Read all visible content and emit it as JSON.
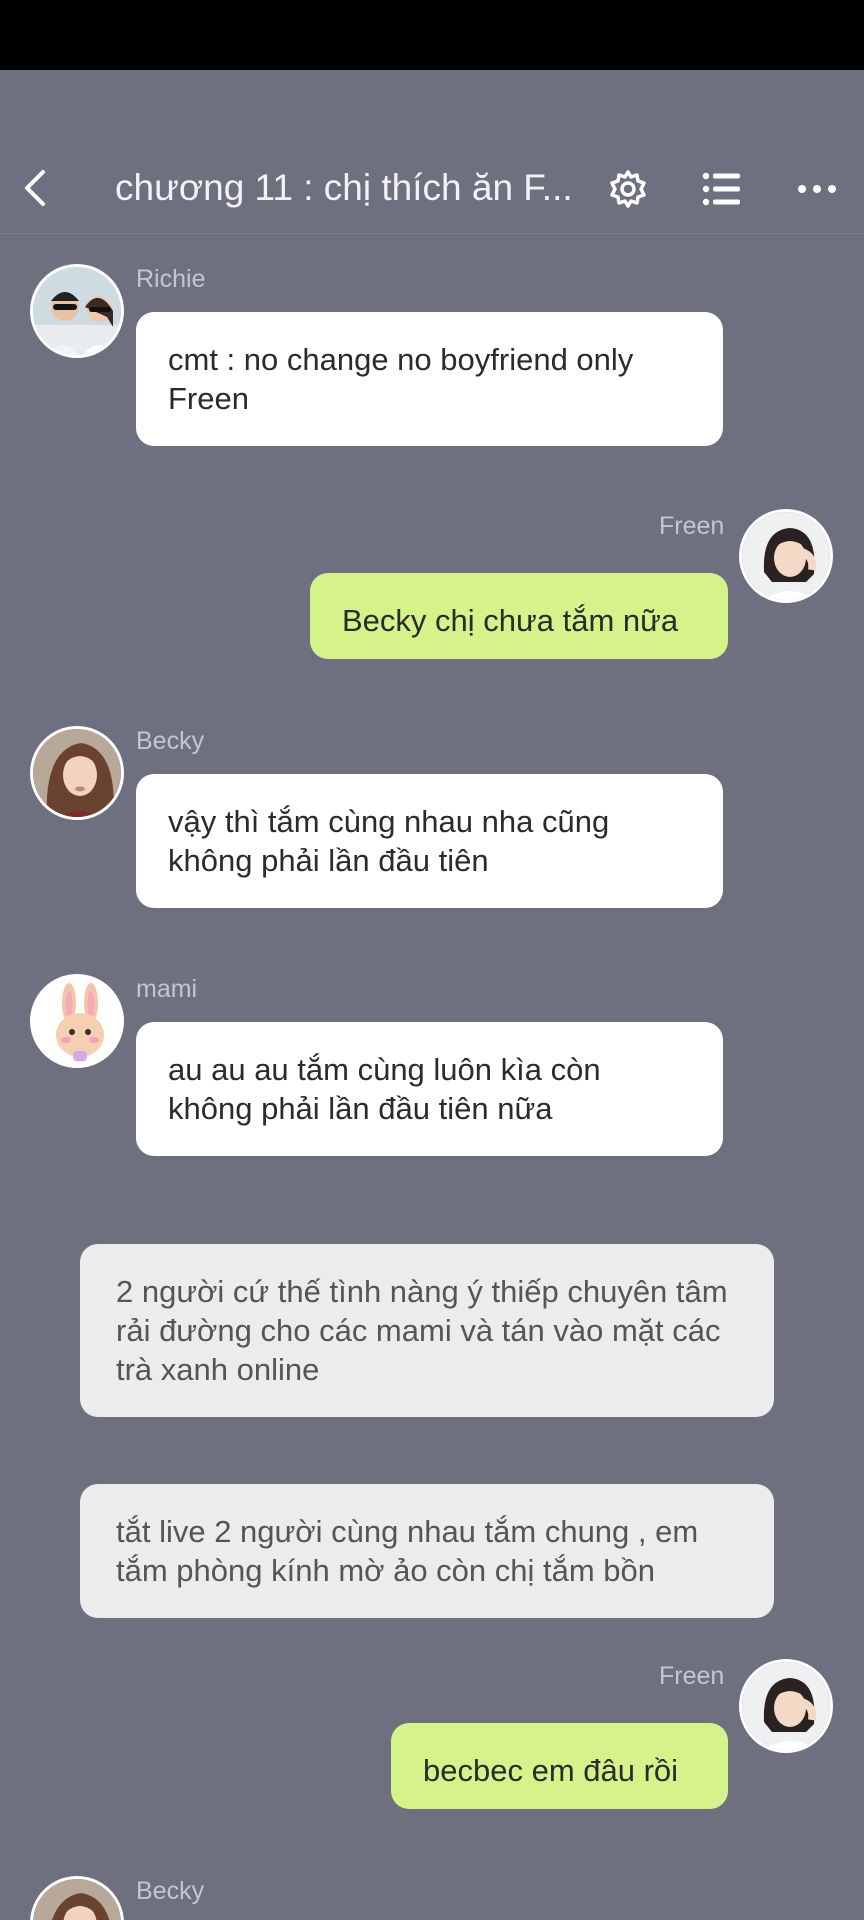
{
  "header": {
    "title": "chương 11 : chị thích ăn F..."
  },
  "messages": [
    {
      "type": "left",
      "sender": "Richie",
      "text": "cmt : no change no boyfriend only Freen",
      "avatar": "richie-avatar"
    },
    {
      "type": "right",
      "sender": "Freen",
      "text": "Becky chị chưa tắm nữa",
      "avatar": "freen-avatar"
    },
    {
      "type": "left",
      "sender": "Becky",
      "text": "vậy thì tắm cùng nhau nha cũng không phải lần đầu tiên",
      "avatar": "becky-avatar"
    },
    {
      "type": "left",
      "sender": "mami",
      "text": "au au au tắm cùng luôn kìa còn không phải lần đầu tiên nữa",
      "avatar": "bunny-avatar"
    },
    {
      "type": "narration",
      "text": "2 người cứ thế tình nàng ý thiếp chuyên tâm rải đường cho các mami và tán vào mặt các trà xanh online"
    },
    {
      "type": "narration",
      "text": "tắt live 2 người cùng nhau tắm chung , em tắm phòng kính mờ ảo còn chị tắm bồn"
    },
    {
      "type": "right",
      "sender": "Freen",
      "text": "becbec em đâu rồi",
      "avatar": "freen-avatar"
    },
    {
      "type": "left",
      "sender": "Becky",
      "text": "",
      "avatar": "becky-avatar"
    }
  ],
  "colors": {
    "background": "#6e7080",
    "bubble_left": "#ffffff",
    "bubble_right": "#d5f28b",
    "narration": "#ececec"
  },
  "icons": [
    "back-arrow-icon",
    "gear-icon",
    "list-icon",
    "more-dots-icon"
  ]
}
